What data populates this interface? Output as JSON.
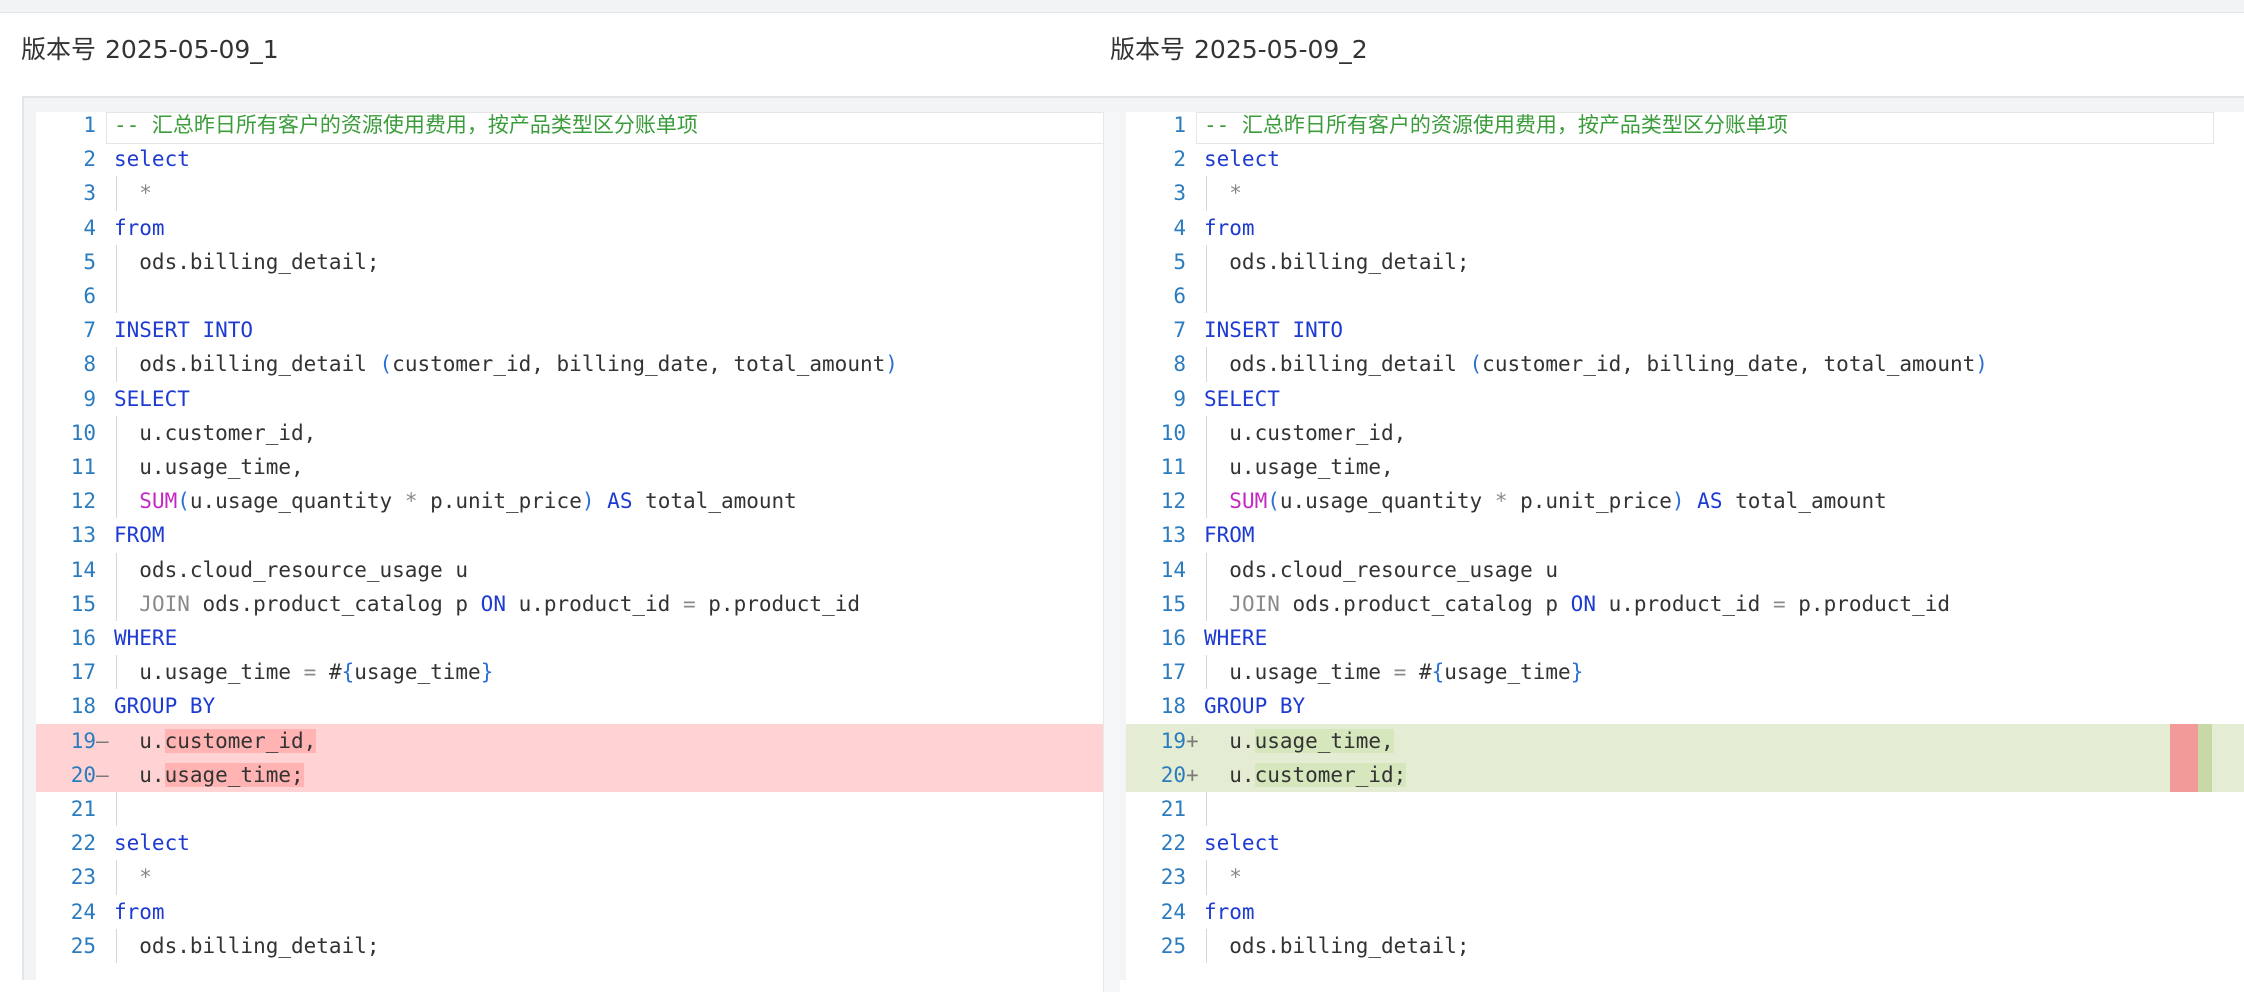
{
  "versions": {
    "left": {
      "label": "版本号",
      "value": "2025-05-09_1"
    },
    "right": {
      "label": "版本号",
      "value": "2025-05-09_2"
    }
  },
  "colors": {
    "removed_row": "#ffd3d3",
    "removed_highlight": "#ffb3b3",
    "added_row": "#e4edd3",
    "added_highlight": "#d6e6bd",
    "keyword": "#1d3ad1",
    "comment": "#3b9c3b",
    "function": "#c428c4",
    "line_number": "#2b7bbf"
  },
  "panes": {
    "left": {
      "lines": [
        {
          "num": "1",
          "mark": "",
          "diff": "",
          "guide": false,
          "tokens": [
            {
              "t": "-- 汇总昨日所有客户的资源使用费用，按产品类型区分账单项",
              "c": "comment"
            }
          ]
        },
        {
          "num": "2",
          "mark": "",
          "diff": "",
          "guide": false,
          "tokens": [
            {
              "t": "select",
              "c": "kw"
            }
          ]
        },
        {
          "num": "3",
          "mark": "",
          "diff": "",
          "guide": true,
          "tokens": [
            {
              "t": "  ",
              "c": "text"
            },
            {
              "t": "*",
              "c": "op"
            }
          ]
        },
        {
          "num": "4",
          "mark": "",
          "diff": "",
          "guide": false,
          "tokens": [
            {
              "t": "from",
              "c": "kw"
            }
          ]
        },
        {
          "num": "5",
          "mark": "",
          "diff": "",
          "guide": true,
          "tokens": [
            {
              "t": "  ods.billing_detail;",
              "c": "text"
            }
          ]
        },
        {
          "num": "6",
          "mark": "",
          "diff": "",
          "guide": true,
          "tokens": []
        },
        {
          "num": "7",
          "mark": "",
          "diff": "",
          "guide": false,
          "tokens": [
            {
              "t": "INSERT INTO",
              "c": "kw"
            }
          ]
        },
        {
          "num": "8",
          "mark": "",
          "diff": "",
          "guide": true,
          "tokens": [
            {
              "t": "  ods.billing_detail ",
              "c": "text"
            },
            {
              "t": "(",
              "c": "paren"
            },
            {
              "t": "customer_id, billing_date, total_amount",
              "c": "text"
            },
            {
              "t": ")",
              "c": "paren"
            }
          ]
        },
        {
          "num": "9",
          "mark": "",
          "diff": "",
          "guide": false,
          "tokens": [
            {
              "t": "SELECT",
              "c": "kw"
            }
          ]
        },
        {
          "num": "10",
          "mark": "",
          "diff": "",
          "guide": true,
          "tokens": [
            {
              "t": "  u.customer_id,",
              "c": "text"
            }
          ]
        },
        {
          "num": "11",
          "mark": "",
          "diff": "",
          "guide": true,
          "tokens": [
            {
              "t": "  u.usage_time,",
              "c": "text"
            }
          ]
        },
        {
          "num": "12",
          "mark": "",
          "diff": "",
          "guide": true,
          "tokens": [
            {
              "t": "  ",
              "c": "text"
            },
            {
              "t": "SUM",
              "c": "fn"
            },
            {
              "t": "(",
              "c": "paren"
            },
            {
              "t": "u.usage_quantity ",
              "c": "text"
            },
            {
              "t": "*",
              "c": "op"
            },
            {
              "t": " p.unit_price",
              "c": "text"
            },
            {
              "t": ")",
              "c": "paren"
            },
            {
              "t": " ",
              "c": "text"
            },
            {
              "t": "AS",
              "c": "kw"
            },
            {
              "t": " total_amount",
              "c": "text"
            }
          ]
        },
        {
          "num": "13",
          "mark": "",
          "diff": "",
          "guide": false,
          "tokens": [
            {
              "t": "FROM",
              "c": "kw"
            }
          ]
        },
        {
          "num": "14",
          "mark": "",
          "diff": "",
          "guide": true,
          "tokens": [
            {
              "t": "  ods.cloud_resource_usage u",
              "c": "text"
            }
          ]
        },
        {
          "num": "15",
          "mark": "",
          "diff": "",
          "guide": true,
          "tokens": [
            {
              "t": "  ",
              "c": "text"
            },
            {
              "t": "JOIN",
              "c": "op"
            },
            {
              "t": " ods.product_catalog p ",
              "c": "text"
            },
            {
              "t": "ON",
              "c": "kw"
            },
            {
              "t": " u.product_id ",
              "c": "text"
            },
            {
              "t": "=",
              "c": "op"
            },
            {
              "t": " p.product_id",
              "c": "text"
            }
          ]
        },
        {
          "num": "16",
          "mark": "",
          "diff": "",
          "guide": false,
          "tokens": [
            {
              "t": "WHERE",
              "c": "kw"
            }
          ]
        },
        {
          "num": "17",
          "mark": "",
          "diff": "",
          "guide": true,
          "tokens": [
            {
              "t": "  u.usage_time ",
              "c": "text"
            },
            {
              "t": "=",
              "c": "op"
            },
            {
              "t": " #",
              "c": "text"
            },
            {
              "t": "{",
              "c": "paren"
            },
            {
              "t": "usage_time",
              "c": "text"
            },
            {
              "t": "}",
              "c": "paren"
            }
          ]
        },
        {
          "num": "18",
          "mark": "",
          "diff": "",
          "guide": false,
          "tokens": [
            {
              "t": "GROUP BY",
              "c": "kw"
            }
          ]
        },
        {
          "num": "19",
          "mark": "—",
          "diff": "removed",
          "guide": false,
          "tokens": [
            {
              "t": "  u.",
              "c": "text"
            },
            {
              "t": "customer_id,",
              "c": "hl"
            }
          ]
        },
        {
          "num": "20",
          "mark": "—",
          "diff": "removed",
          "guide": false,
          "tokens": [
            {
              "t": "  u.",
              "c": "text"
            },
            {
              "t": "usage_time;",
              "c": "hl"
            }
          ]
        },
        {
          "num": "21",
          "mark": "",
          "diff": "",
          "guide": true,
          "tokens": []
        },
        {
          "num": "22",
          "mark": "",
          "diff": "",
          "guide": false,
          "tokens": [
            {
              "t": "select",
              "c": "kw"
            }
          ]
        },
        {
          "num": "23",
          "mark": "",
          "diff": "",
          "guide": true,
          "tokens": [
            {
              "t": "  ",
              "c": "text"
            },
            {
              "t": "*",
              "c": "op"
            }
          ]
        },
        {
          "num": "24",
          "mark": "",
          "diff": "",
          "guide": false,
          "tokens": [
            {
              "t": "from",
              "c": "kw"
            }
          ]
        },
        {
          "num": "25",
          "mark": "",
          "diff": "",
          "guide": true,
          "tokens": [
            {
              "t": "  ods.billing_detail;",
              "c": "text"
            }
          ]
        }
      ]
    },
    "right": {
      "lines": [
        {
          "num": "1",
          "mark": "",
          "diff": "",
          "guide": false,
          "tokens": [
            {
              "t": "-- 汇总昨日所有客户的资源使用费用，按产品类型区分账单项",
              "c": "comment"
            }
          ]
        },
        {
          "num": "2",
          "mark": "",
          "diff": "",
          "guide": false,
          "tokens": [
            {
              "t": "select",
              "c": "kw"
            }
          ]
        },
        {
          "num": "3",
          "mark": "",
          "diff": "",
          "guide": true,
          "tokens": [
            {
              "t": "  ",
              "c": "text"
            },
            {
              "t": "*",
              "c": "op"
            }
          ]
        },
        {
          "num": "4",
          "mark": "",
          "diff": "",
          "guide": false,
          "tokens": [
            {
              "t": "from",
              "c": "kw"
            }
          ]
        },
        {
          "num": "5",
          "mark": "",
          "diff": "",
          "guide": true,
          "tokens": [
            {
              "t": "  ods.billing_detail;",
              "c": "text"
            }
          ]
        },
        {
          "num": "6",
          "mark": "",
          "diff": "",
          "guide": true,
          "tokens": []
        },
        {
          "num": "7",
          "mark": "",
          "diff": "",
          "guide": false,
          "tokens": [
            {
              "t": "INSERT INTO",
              "c": "kw"
            }
          ]
        },
        {
          "num": "8",
          "mark": "",
          "diff": "",
          "guide": true,
          "tokens": [
            {
              "t": "  ods.billing_detail ",
              "c": "text"
            },
            {
              "t": "(",
              "c": "paren"
            },
            {
              "t": "customer_id, billing_date, total_amount",
              "c": "text"
            },
            {
              "t": ")",
              "c": "paren"
            }
          ]
        },
        {
          "num": "9",
          "mark": "",
          "diff": "",
          "guide": false,
          "tokens": [
            {
              "t": "SELECT",
              "c": "kw"
            }
          ]
        },
        {
          "num": "10",
          "mark": "",
          "diff": "",
          "guide": true,
          "tokens": [
            {
              "t": "  u.customer_id,",
              "c": "text"
            }
          ]
        },
        {
          "num": "11",
          "mark": "",
          "diff": "",
          "guide": true,
          "tokens": [
            {
              "t": "  u.usage_time,",
              "c": "text"
            }
          ]
        },
        {
          "num": "12",
          "mark": "",
          "diff": "",
          "guide": true,
          "tokens": [
            {
              "t": "  ",
              "c": "text"
            },
            {
              "t": "SUM",
              "c": "fn"
            },
            {
              "t": "(",
              "c": "paren"
            },
            {
              "t": "u.usage_quantity ",
              "c": "text"
            },
            {
              "t": "*",
              "c": "op"
            },
            {
              "t": " p.unit_price",
              "c": "text"
            },
            {
              "t": ")",
              "c": "paren"
            },
            {
              "t": " ",
              "c": "text"
            },
            {
              "t": "AS",
              "c": "kw"
            },
            {
              "t": " total_amount",
              "c": "text"
            }
          ]
        },
        {
          "num": "13",
          "mark": "",
          "diff": "",
          "guide": false,
          "tokens": [
            {
              "t": "FROM",
              "c": "kw"
            }
          ]
        },
        {
          "num": "14",
          "mark": "",
          "diff": "",
          "guide": true,
          "tokens": [
            {
              "t": "  ods.cloud_resource_usage u",
              "c": "text"
            }
          ]
        },
        {
          "num": "15",
          "mark": "",
          "diff": "",
          "guide": true,
          "tokens": [
            {
              "t": "  ",
              "c": "text"
            },
            {
              "t": "JOIN",
              "c": "op"
            },
            {
              "t": " ods.product_catalog p ",
              "c": "text"
            },
            {
              "t": "ON",
              "c": "kw"
            },
            {
              "t": " u.product_id ",
              "c": "text"
            },
            {
              "t": "=",
              "c": "op"
            },
            {
              "t": " p.product_id",
              "c": "text"
            }
          ]
        },
        {
          "num": "16",
          "mark": "",
          "diff": "",
          "guide": false,
          "tokens": [
            {
              "t": "WHERE",
              "c": "kw"
            }
          ]
        },
        {
          "num": "17",
          "mark": "",
          "diff": "",
          "guide": true,
          "tokens": [
            {
              "t": "  u.usage_time ",
              "c": "text"
            },
            {
              "t": "=",
              "c": "op"
            },
            {
              "t": " #",
              "c": "text"
            },
            {
              "t": "{",
              "c": "paren"
            },
            {
              "t": "usage_time",
              "c": "text"
            },
            {
              "t": "}",
              "c": "paren"
            }
          ]
        },
        {
          "num": "18",
          "mark": "",
          "diff": "",
          "guide": false,
          "tokens": [
            {
              "t": "GROUP BY",
              "c": "kw"
            }
          ]
        },
        {
          "num": "19",
          "mark": "+",
          "diff": "added",
          "guide": false,
          "tokens": [
            {
              "t": "  u.",
              "c": "text"
            },
            {
              "t": "usage_time,",
              "c": "hl"
            }
          ]
        },
        {
          "num": "20",
          "mark": "+",
          "diff": "added",
          "guide": false,
          "tokens": [
            {
              "t": "  u.",
              "c": "text"
            },
            {
              "t": "customer_id;",
              "c": "hl"
            }
          ]
        },
        {
          "num": "21",
          "mark": "",
          "diff": "",
          "guide": true,
          "tokens": []
        },
        {
          "num": "22",
          "mark": "",
          "diff": "",
          "guide": false,
          "tokens": [
            {
              "t": "select",
              "c": "kw"
            }
          ]
        },
        {
          "num": "23",
          "mark": "",
          "diff": "",
          "guide": true,
          "tokens": [
            {
              "t": "  ",
              "c": "text"
            },
            {
              "t": "*",
              "c": "op"
            }
          ]
        },
        {
          "num": "24",
          "mark": "",
          "diff": "",
          "guide": false,
          "tokens": [
            {
              "t": "from",
              "c": "kw"
            }
          ]
        },
        {
          "num": "25",
          "mark": "",
          "diff": "",
          "guide": true,
          "tokens": [
            {
              "t": "  ods.billing_detail;",
              "c": "text"
            }
          ]
        }
      ]
    }
  }
}
